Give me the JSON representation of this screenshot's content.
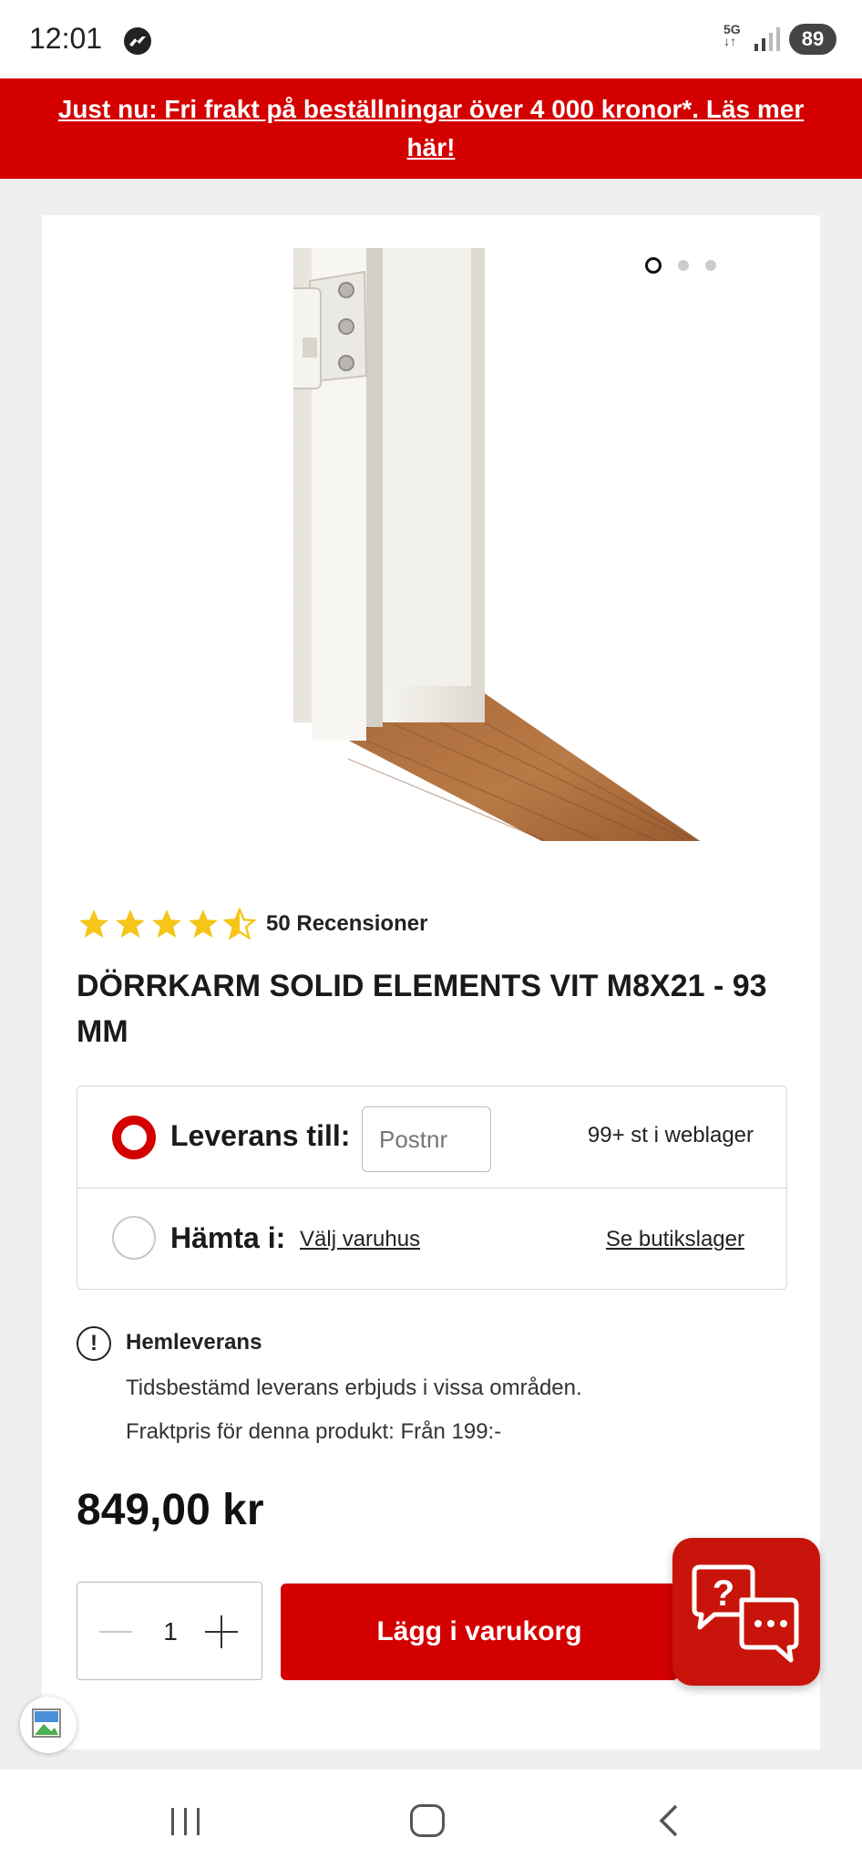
{
  "status_bar": {
    "time": "12:01",
    "network": "5G",
    "battery": "89",
    "icons": [
      "messenger-icon",
      "network-5g-icon",
      "signal-icon",
      "battery-icon"
    ]
  },
  "promo": {
    "text": "Just nu: Fri frakt på beställningar över 4 000 kronor*. Läs mer här!"
  },
  "product": {
    "image_alt": "door-frame-image",
    "carousel": {
      "count": 3,
      "active": 1
    },
    "rating": {
      "value": 4.5,
      "max": 5
    },
    "reviews": "50 Recensioner",
    "title": "DÖRRKARM SOLID ELEMENTS VIT M8X21 - 93 MM"
  },
  "delivery": {
    "option_delivery": {
      "label": "Leverans till:",
      "placeholder": "Postnr",
      "value": "",
      "stock": "99+ st i weblager",
      "selected": true
    },
    "option_pickup": {
      "label": "Hämta i:",
      "store_link": "Välj varuhus",
      "stock_link": "Se butikslager",
      "selected": false
    }
  },
  "home_delivery": {
    "icon": "!",
    "title": "Hemleverans",
    "line1": "Tidsbestämd leverans erbjuds i vissa områden.",
    "line2": "Fraktpris för denna produkt: Från 199:-"
  },
  "purchase": {
    "price": "849,00 kr",
    "quantity": "1",
    "add_to_cart": "Lägg i varukorg"
  },
  "colors": {
    "brand_red": "#d40000",
    "star_yellow": "#f5c518",
    "page_bg": "#efefef"
  }
}
